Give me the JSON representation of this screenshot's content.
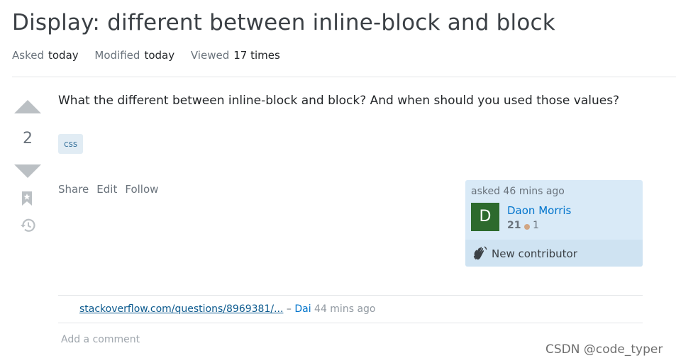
{
  "question": {
    "title": "Display: different between inline-block and block",
    "meta": {
      "asked_label": "Asked",
      "asked_value": "today",
      "modified_label": "Modified",
      "modified_value": "today",
      "viewed_label": "Viewed",
      "viewed_value": "17 times"
    },
    "vote_count": "2",
    "body": "What the different between inline-block and block? And when should you used those values?",
    "tags": [
      "css"
    ]
  },
  "post_menu": {
    "share": "Share",
    "edit": "Edit",
    "follow": "Follow"
  },
  "user_card": {
    "asked_time": "asked 46 mins ago",
    "avatar_letter": "D",
    "name": "Daon Morris",
    "reputation": "21",
    "bronze_badges": "1",
    "new_contributor": "New contributor"
  },
  "comment": {
    "link": "stackoverflow.com/questions/8969381/...",
    "separator": "–",
    "author": "Dai",
    "time": "44 mins ago"
  },
  "add_comment": "Add a comment",
  "watermark": "CSDN @code_typer",
  "colors": {
    "link_blue": "#0074cc",
    "tag_bg": "#e1ecf4",
    "tag_text": "#39739d",
    "user_card_bg": "#d9eaf7",
    "avatar_bg": "#2d6a2d"
  }
}
